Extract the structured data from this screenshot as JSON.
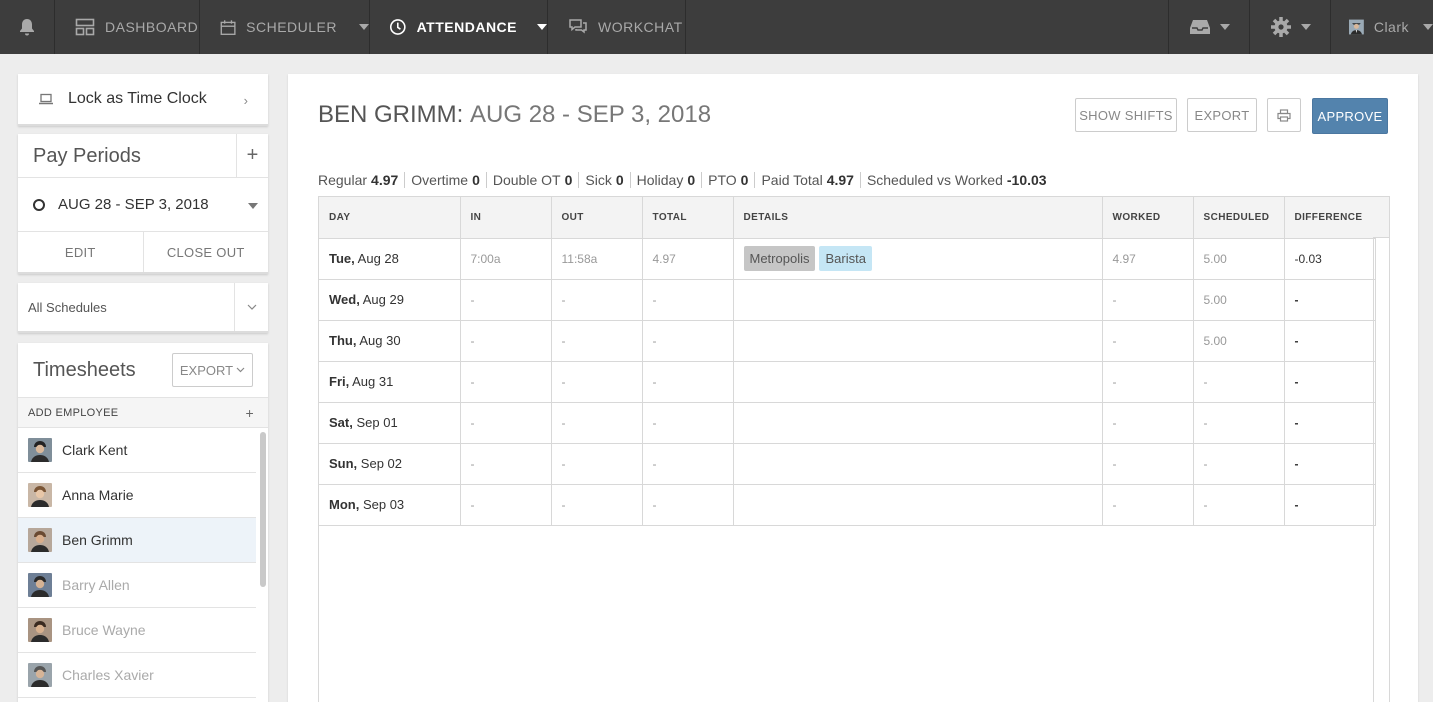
{
  "nav": {
    "dashboard": "DASHBOARD",
    "scheduler": "SCHEDULER",
    "attendance": "ATTENDANCE",
    "workchat": "WORKCHAT",
    "user": "Clark"
  },
  "sidebar": {
    "lock_label": "Lock as Time Clock",
    "pay_periods_title": "Pay Periods",
    "current_period": "AUG 28 - SEP 3, 2018",
    "edit": "EDIT",
    "close_out": "CLOSE OUT",
    "schedule_filter": "All Schedules",
    "timesheets_title": "Timesheets",
    "export": "EXPORT",
    "add_employee": "ADD EMPLOYEE",
    "employees": [
      {
        "name": "Clark Kent",
        "selected": false,
        "inactive": false
      },
      {
        "name": "Anna Marie",
        "selected": false,
        "inactive": false
      },
      {
        "name": "Ben Grimm",
        "selected": true,
        "inactive": false
      },
      {
        "name": "Barry Allen",
        "selected": false,
        "inactive": true
      },
      {
        "name": "Bruce Wayne",
        "selected": false,
        "inactive": true
      },
      {
        "name": "Charles Xavier",
        "selected": false,
        "inactive": true
      }
    ]
  },
  "main": {
    "employee_name": "BEN GRIMM:",
    "range": "AUG 28 - SEP 3, 2018",
    "show_shifts": "SHOW SHIFTS",
    "export": "EXPORT",
    "approve": "APPROVE",
    "summary": [
      {
        "label": "Regular",
        "value": "4.97"
      },
      {
        "label": "Overtime",
        "value": "0"
      },
      {
        "label": "Double OT",
        "value": "0"
      },
      {
        "label": "Sick",
        "value": "0"
      },
      {
        "label": "Holiday",
        "value": "0"
      },
      {
        "label": "PTO",
        "value": "0"
      },
      {
        "label": "Paid Total",
        "value": "4.97"
      },
      {
        "label": "Scheduled vs Worked",
        "value": "-10.03"
      }
    ],
    "columns": [
      "DAY",
      "IN",
      "OUT",
      "TOTAL",
      "DETAILS",
      "WORKED",
      "SCHEDULED",
      "DIFFERENCE"
    ],
    "rows": [
      {
        "dow": "Tue,",
        "date": "Aug 28",
        "in": "7:00a",
        "out": "11:58a",
        "total": "4.97",
        "location": "Metropolis",
        "position": "Barista",
        "worked": "4.97",
        "scheduled": "5.00",
        "difference": "-0.03"
      },
      {
        "dow": "Wed,",
        "date": "Aug 29",
        "in": "-",
        "out": "-",
        "total": "-",
        "location": "",
        "position": "",
        "worked": "-",
        "scheduled": "5.00",
        "difference": "-"
      },
      {
        "dow": "Thu,",
        "date": "Aug 30",
        "in": "-",
        "out": "-",
        "total": "-",
        "location": "",
        "position": "",
        "worked": "-",
        "scheduled": "5.00",
        "difference": "-"
      },
      {
        "dow": "Fri,",
        "date": "Aug 31",
        "in": "-",
        "out": "-",
        "total": "-",
        "location": "",
        "position": "",
        "worked": "-",
        "scheduled": "-",
        "difference": "-"
      },
      {
        "dow": "Sat,",
        "date": "Sep 01",
        "in": "-",
        "out": "-",
        "total": "-",
        "location": "",
        "position": "",
        "worked": "-",
        "scheduled": "-",
        "difference": "-"
      },
      {
        "dow": "Sun,",
        "date": "Sep 02",
        "in": "-",
        "out": "-",
        "total": "-",
        "location": "",
        "position": "",
        "worked": "-",
        "scheduled": "-",
        "difference": "-"
      },
      {
        "dow": "Mon,",
        "date": "Sep 03",
        "in": "-",
        "out": "-",
        "total": "-",
        "location": "",
        "position": "",
        "worked": "-",
        "scheduled": "-",
        "difference": "-"
      }
    ]
  },
  "colors": {
    "nav_bg": "#3d3d3d",
    "approve": "#5383ad",
    "location_tag": "#c6c6c6",
    "position_tag": "#c5e6f5",
    "selected_row": "#edf3f9"
  }
}
